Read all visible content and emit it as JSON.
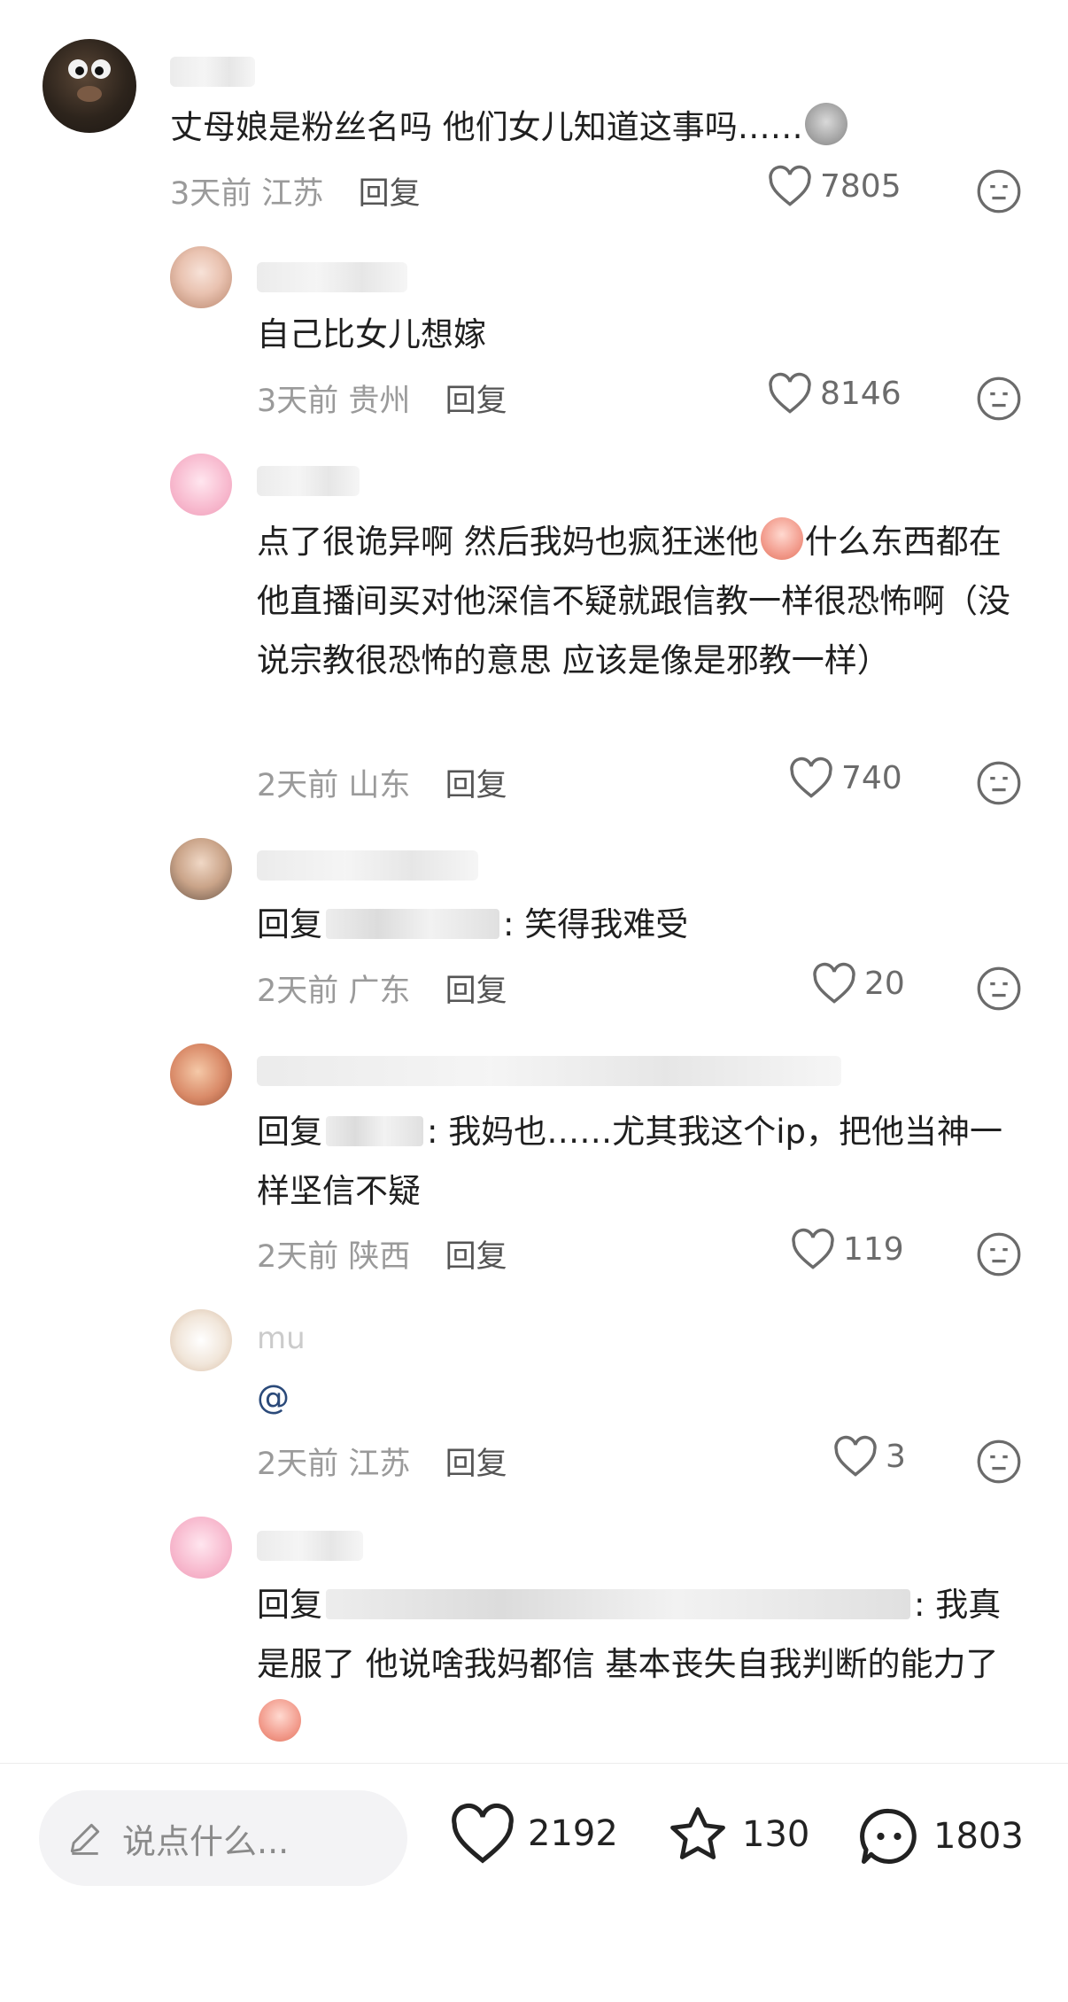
{
  "comments": [
    {
      "text": "丈母娘是粉丝名吗 他们女儿知道这事吗……",
      "emoji": "sweat-emoji",
      "time": "3天前",
      "location": "江苏",
      "reply_label": "回复",
      "likes": "7805"
    },
    {
      "text": "自己比女儿想嫁",
      "time": "3天前",
      "location": "贵州",
      "reply_label": "回复",
      "likes": "8146"
    },
    {
      "text_a": "点了很诡异啊 然后我妈也疯狂迷他",
      "emoji": "crying-emoji",
      "text_b": "什么东西都在他直播间买对他深信不疑就跟信教一样很恐怖啊（没说宗教很恐怖的意思 应该是像是邪教一样）",
      "time": "2天前",
      "location": "山东",
      "reply_label": "回复",
      "likes": "740"
    },
    {
      "prefix": "回复",
      "suffix": ": 笑得我难受",
      "time": "2天前",
      "location": "广东",
      "reply_label": "回复",
      "likes": "20"
    },
    {
      "prefix": "回复",
      "suffix": ": 我妈也……尤其我这个ip，把他当神一样坚信不疑",
      "time": "2天前",
      "location": "陕西",
      "reply_label": "回复",
      "likes": "119"
    },
    {
      "username": "mu",
      "text": "@",
      "time": "2天前",
      "location": "江苏",
      "reply_label": "回复",
      "likes": "3"
    },
    {
      "prefix": "回复",
      "suffix": ": 我真是服了 他说啥我妈都信 基本丧失自我判断的能力了",
      "emoji": "crying-emoji"
    }
  ],
  "bottom_bar": {
    "input_placeholder": "说点什么...",
    "likes": "2192",
    "favorites": "130",
    "comments": "1803"
  },
  "colors": {
    "text": "#1f1f1f",
    "meta": "#9a9a9a",
    "input_bg": "#f3f3f5"
  }
}
